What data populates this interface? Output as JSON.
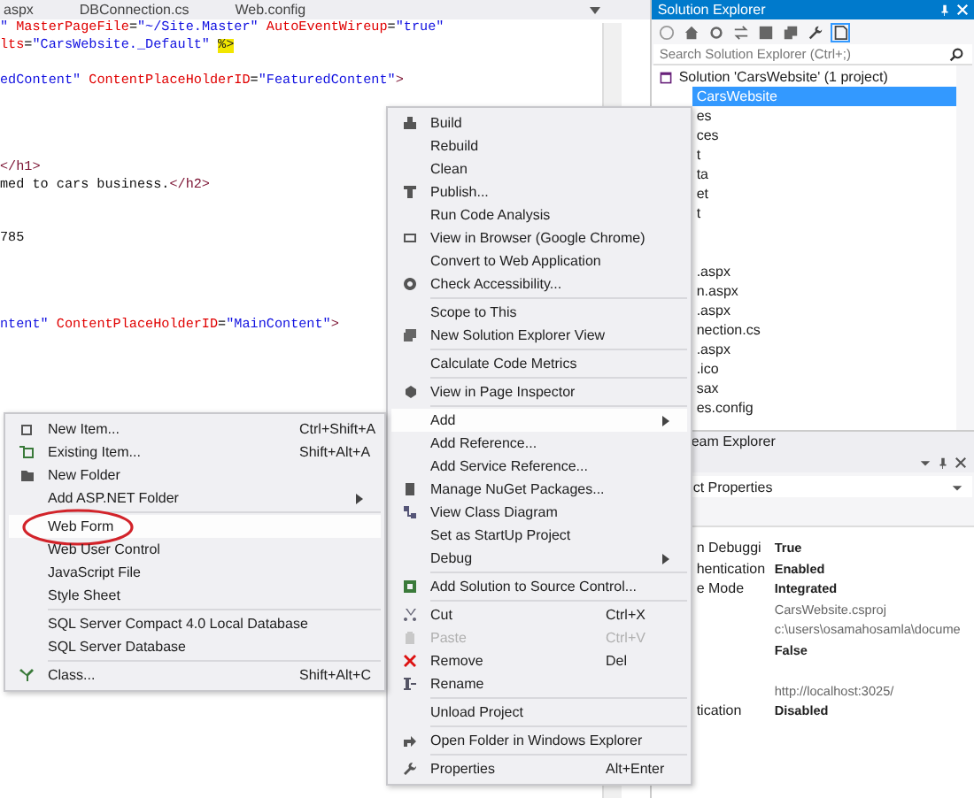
{
  "editor": {
    "tabs": [
      {
        "label": "aspx",
        "selected": false
      },
      {
        "label": "DBConnection.cs",
        "selected": false
      },
      {
        "label": "Web.config",
        "selected": false
      }
    ],
    "code_lines": [
      {
        "kind": "code",
        "segments": [
          {
            "kind": "value",
            "text": "\" "
          },
          {
            "kind": "attr",
            "text": "MasterPageFile"
          },
          {
            "kind": "text",
            "text": "="
          },
          {
            "kind": "value",
            "text": "\"~/Site.Master\" "
          },
          {
            "kind": "attr",
            "text": "AutoEventWireup"
          },
          {
            "kind": "text",
            "text": "="
          },
          {
            "kind": "value",
            "text": "\"true\""
          }
        ]
      },
      {
        "kind": "code",
        "segments": [
          {
            "kind": "attr",
            "text": "lts"
          },
          {
            "kind": "text",
            "text": "="
          },
          {
            "kind": "value",
            "text": "\"CarsWebsite._Default\" "
          },
          {
            "kind": "mark",
            "text": "%>"
          }
        ]
      },
      {
        "kind": "blank"
      },
      {
        "kind": "code",
        "segments": [
          {
            "kind": "value",
            "text": "edContent\" "
          },
          {
            "kind": "attr",
            "text": "ContentPlaceHolderID"
          },
          {
            "kind": "text",
            "text": "="
          },
          {
            "kind": "value",
            "text": "\"FeaturedContent\""
          },
          {
            "kind": "tag",
            "text": ">"
          }
        ]
      },
      {
        "kind": "blank"
      },
      {
        "kind": "blank"
      },
      {
        "kind": "blank"
      },
      {
        "kind": "blank"
      },
      {
        "kind": "code",
        "segments": [
          {
            "kind": "tag",
            "text": "</h1>"
          }
        ]
      },
      {
        "kind": "code",
        "segments": [
          {
            "kind": "text",
            "text": "med to cars business."
          },
          {
            "kind": "tag",
            "text": "</h2>"
          }
        ]
      },
      {
        "kind": "blank"
      },
      {
        "kind": "blank"
      },
      {
        "kind": "code",
        "segments": [
          {
            "kind": "text",
            "text": "785"
          }
        ]
      },
      {
        "kind": "blank"
      },
      {
        "kind": "blank"
      },
      {
        "kind": "blank"
      },
      {
        "kind": "blank"
      },
      {
        "kind": "code",
        "segments": [
          {
            "kind": "value",
            "text": "ntent\" "
          },
          {
            "kind": "attr",
            "text": "ContentPlaceHolderID"
          },
          {
            "kind": "text",
            "text": "="
          },
          {
            "kind": "value",
            "text": "\"MainContent\""
          },
          {
            "kind": "tag",
            "text": ">"
          }
        ]
      }
    ]
  },
  "solution_explorer": {
    "title": "Solution Explorer",
    "search": {
      "placeholder": "Search Solution Explorer (Ctrl+;)"
    },
    "tree": [
      {
        "kind": "root",
        "label": "Solution 'CarsWebsite' (1 project)",
        "selected": false
      },
      {
        "kind": "item",
        "label": "CarsWebsite",
        "selected": true
      },
      {
        "kind": "item",
        "label": "es",
        "selected": false
      },
      {
        "kind": "item",
        "label": "ces",
        "selected": false
      },
      {
        "kind": "item",
        "label": "t",
        "selected": false
      },
      {
        "kind": "item",
        "label": "ta",
        "selected": false
      },
      {
        "kind": "item",
        "label": "et",
        "selected": false
      },
      {
        "kind": "item",
        "label": "t",
        "selected": false
      },
      {
        "kind": "covered"
      },
      {
        "kind": "covered"
      },
      {
        "kind": "item",
        "label": ".aspx",
        "selected": false
      },
      {
        "kind": "item",
        "label": "n.aspx",
        "selected": false
      },
      {
        "kind": "item",
        "label": ".aspx",
        "selected": false
      },
      {
        "kind": "item",
        "label": "nection.cs",
        "selected": false
      },
      {
        "kind": "item",
        "label": ".aspx",
        "selected": false
      },
      {
        "kind": "item",
        "label": ".ico",
        "selected": false
      },
      {
        "kind": "item",
        "label": "sax",
        "selected": false
      },
      {
        "kind": "item",
        "label": "es.config",
        "selected": false
      }
    ],
    "bottom_tab": "eam Explorer"
  },
  "properties": {
    "object": "ct Properties",
    "rows": [
      {
        "name": "n Debuggi",
        "value": "True",
        "bold": true
      },
      {
        "name": "hentication",
        "value": "Enabled",
        "bold": true
      },
      {
        "name": "e Mode",
        "value": "Integrated",
        "bold": true
      },
      {
        "value": "CarsWebsite.csproj",
        "bold": false
      },
      {
        "value": "c:\\users\\osamahosamla\\docume",
        "bold": false
      },
      {
        "value": "False",
        "bold": true
      },
      {
        "value": "http://localhost:3025/",
        "bold": false,
        "gap_before": true
      },
      {
        "name": "tication",
        "value": "Disabled",
        "bold": true
      }
    ]
  },
  "context_menu": [
    {
      "kind": "item",
      "label": "Build",
      "selected": false,
      "disabled": false,
      "submenu": false
    },
    {
      "kind": "item",
      "label": "Rebuild",
      "selected": false,
      "disabled": false,
      "submenu": false
    },
    {
      "kind": "item",
      "label": "Clean",
      "selected": false,
      "disabled": false,
      "submenu": false
    },
    {
      "kind": "item",
      "label": "Publish...",
      "selected": false,
      "disabled": false,
      "submenu": false
    },
    {
      "kind": "item",
      "label": "Run Code Analysis",
      "selected": false,
      "disabled": false,
      "submenu": false
    },
    {
      "kind": "item",
      "label": "View in Browser (Google Chrome)",
      "selected": false,
      "disabled": false,
      "submenu": false
    },
    {
      "kind": "item",
      "label": "Convert to Web Application",
      "selected": false,
      "disabled": false,
      "submenu": false
    },
    {
      "kind": "item",
      "label": "Check Accessibility...",
      "selected": false,
      "disabled": false,
      "submenu": false
    },
    {
      "kind": "separator"
    },
    {
      "kind": "item",
      "label": "Scope to This",
      "selected": false,
      "disabled": false,
      "submenu": false
    },
    {
      "kind": "item",
      "label": "New Solution Explorer View",
      "selected": false,
      "disabled": false,
      "submenu": false
    },
    {
      "kind": "separator"
    },
    {
      "kind": "item",
      "label": "Calculate Code Metrics",
      "selected": false,
      "disabled": false,
      "submenu": false
    },
    {
      "kind": "separator"
    },
    {
      "kind": "item",
      "label": "View in Page Inspector",
      "selected": false,
      "disabled": false,
      "submenu": false
    },
    {
      "kind": "separator"
    },
    {
      "kind": "item",
      "label": "Add",
      "selected": true,
      "disabled": false,
      "submenu": true
    },
    {
      "kind": "item",
      "label": "Add Reference...",
      "selected": false,
      "disabled": false,
      "submenu": false
    },
    {
      "kind": "item",
      "label": "Add Service Reference...",
      "selected": false,
      "disabled": false,
      "submenu": false
    },
    {
      "kind": "item",
      "label": "Manage NuGet Packages...",
      "selected": false,
      "disabled": false,
      "submenu": false
    },
    {
      "kind": "item",
      "label": "View Class Diagram",
      "selected": false,
      "disabled": false,
      "submenu": false
    },
    {
      "kind": "item",
      "label": "Set as StartUp Project",
      "selected": false,
      "disabled": false,
      "submenu": false
    },
    {
      "kind": "item",
      "label": "Debug",
      "selected": false,
      "disabled": false,
      "submenu": true
    },
    {
      "kind": "separator"
    },
    {
      "kind": "item",
      "label": "Add Solution to Source Control...",
      "selected": false,
      "disabled": false,
      "submenu": false
    },
    {
      "kind": "separator"
    },
    {
      "kind": "item",
      "label": "Cut",
      "shortcut": "Ctrl+X",
      "selected": false,
      "disabled": false,
      "submenu": false
    },
    {
      "kind": "item",
      "label": "Paste",
      "shortcut": "Ctrl+V",
      "selected": false,
      "disabled": true,
      "submenu": false
    },
    {
      "kind": "item",
      "label": "Remove",
      "shortcut": "Del",
      "selected": false,
      "disabled": false,
      "submenu": false
    },
    {
      "kind": "item",
      "label": "Rename",
      "selected": false,
      "disabled": false,
      "submenu": false
    },
    {
      "kind": "separator"
    },
    {
      "kind": "item",
      "label": "Unload Project",
      "selected": false,
      "disabled": false,
      "submenu": false
    },
    {
      "kind": "separator"
    },
    {
      "kind": "item",
      "label": "Open Folder in Windows Explorer",
      "selected": false,
      "disabled": false,
      "submenu": false
    },
    {
      "kind": "separator"
    },
    {
      "kind": "item",
      "label": "Properties",
      "shortcut": "Alt+Enter",
      "selected": false,
      "disabled": false,
      "submenu": false
    }
  ],
  "add_submenu": [
    {
      "kind": "item",
      "label": "New Item...",
      "shortcut": "Ctrl+Shift+A",
      "selected": false,
      "submenu": false
    },
    {
      "kind": "item",
      "label": "Existing Item...",
      "shortcut": "Shift+Alt+A",
      "selected": false,
      "submenu": false
    },
    {
      "kind": "item",
      "label": "New Folder",
      "selected": false,
      "submenu": false
    },
    {
      "kind": "item",
      "label": "Add ASP.NET Folder",
      "selected": false,
      "submenu": true
    },
    {
      "kind": "separator"
    },
    {
      "kind": "item",
      "label": "Web Form",
      "selected": true,
      "circled": true,
      "submenu": false
    },
    {
      "kind": "item",
      "label": "Web User Control",
      "selected": false,
      "submenu": false
    },
    {
      "kind": "item",
      "label": "JavaScript File",
      "selected": false,
      "submenu": false
    },
    {
      "kind": "item",
      "label": "Style Sheet",
      "selected": false,
      "submenu": false
    },
    {
      "kind": "separator"
    },
    {
      "kind": "item",
      "label": "SQL Server Compact 4.0 Local Database",
      "selected": false,
      "submenu": false
    },
    {
      "kind": "item",
      "label": "SQL Server Database",
      "selected": false,
      "submenu": false
    },
    {
      "kind": "separator"
    },
    {
      "kind": "item",
      "label": "Class...",
      "shortcut": "Shift+Alt+C",
      "selected": false,
      "submenu": false
    }
  ]
}
